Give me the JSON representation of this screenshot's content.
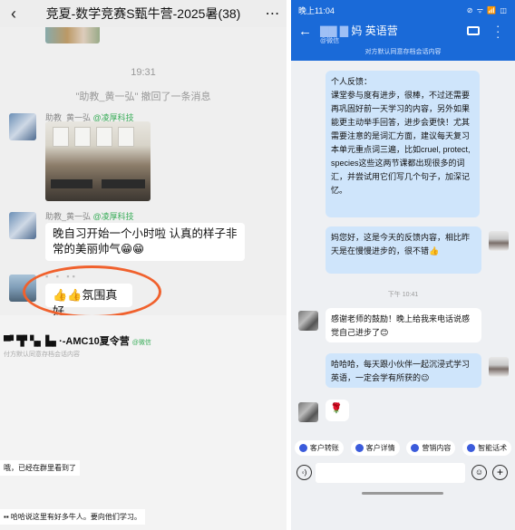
{
  "left_top": {
    "back_icon": "chevron-left-icon",
    "title": "竞夏-数学竞赛S甄牛营-2025暑(38)",
    "more_icon": "more-horizontal-icon",
    "time": "19:31",
    "recall_notice": "\"助教_黄一弘\" 撤回了一条消息",
    "msg1_sender": "助教_黄一弘",
    "msg1_sender_org": "@凌厚科技",
    "msg2_sender": "助教_黄一弘",
    "msg2_sender_org": "@凌厚科技",
    "msg2_text": "晚自习开始一个小时啦 认真的样子非常的美丽帅气😁😁",
    "msg3_text": "👍👍氛围真好",
    "highlight_color": "#f0612d"
  },
  "left_bottom": {
    "group_title": "·-AMC10夏令营",
    "group_tag": "@微信",
    "group_sub": "付方默认同意存档会话内容",
    "msg_a": "哦，已经在群里看到了",
    "msg_b": "哈哈说这里有好多牛人。要向他们学习。"
  },
  "right": {
    "status_time": "晚上11:04",
    "status_icons": "⊘ ᯤ 📶 ◫",
    "contact_name": "妈 英语营",
    "contact_source": "@微信",
    "notice": "对方默认同意存档会话内容",
    "feedback_text": "个人反馈：\n课堂参与度有进步，很棒，不过还需要再巩固好前一天学习的内容，另外如果能更主动举手回答，进步会更快！尤其需要注意的是词汇方面，建议每天复习本单元重点词三遍，比如cruel, protect, species这些这两节课都出现很多的词汇，并尝试用它们写几个句子，加深记忆。",
    "reply1": "妈您好，这是今天的反馈内容，相比昨天是在慢慢进步的，很不错👍",
    "time2": "下午 10:41",
    "cust_msg": "感谢老师的鼓励！晚上给我来电话说感觉自己进步了😊",
    "reply2": "哈哈哈，每天跟小伙伴一起沉浸式学习英语，一定会学有所获的😉",
    "rose": "🌹",
    "tools": [
      "客户转账",
      "客户详情",
      "营销内容",
      "智能话术"
    ],
    "accent_color": "#1a6ad8"
  }
}
